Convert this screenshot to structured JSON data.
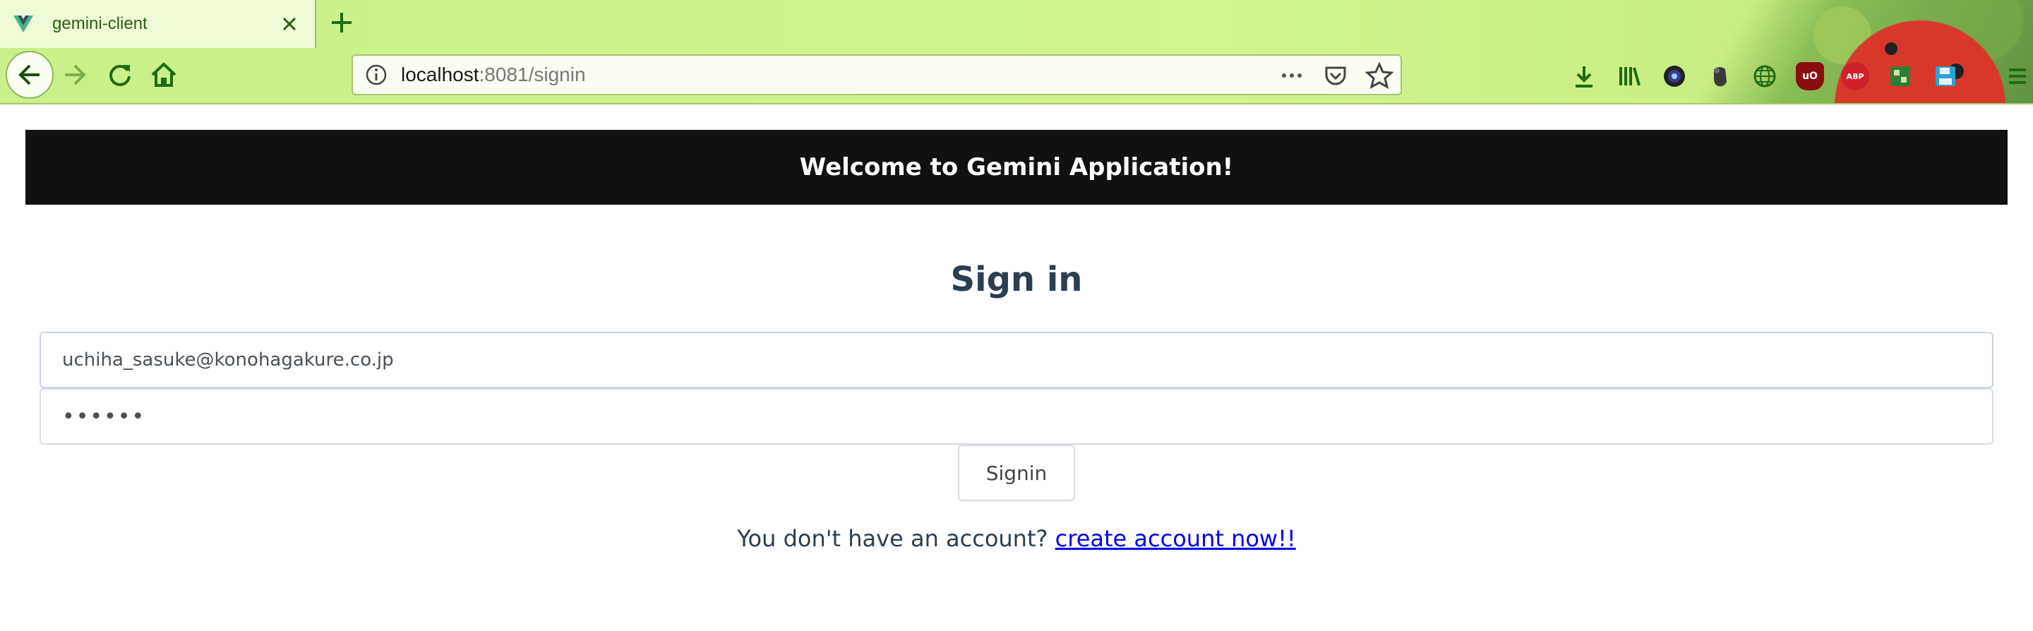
{
  "browser": {
    "tab": {
      "title": "gemini-client",
      "favicon": "vue-logo-icon"
    },
    "url": {
      "host": "localhost",
      "path": ":8081/signin"
    },
    "toolbar_icons": [
      "download-icon",
      "library-icon",
      "camera-extension-icon",
      "evernote-icon",
      "globe-extension-icon",
      "ublock-icon",
      "adblock-icon",
      "extension-icon",
      "save-icon",
      "menu-icon"
    ],
    "extension_labels": {
      "ublock": "uO",
      "adblock": "ABP"
    }
  },
  "page": {
    "banner": "Welcome to Gemini Application!",
    "title": "Sign in",
    "email_value": "uchiha_sasuke@konohagakure.co.jp",
    "password_value": "••••••",
    "signin_button": "Signin",
    "footer_prompt": "You don't have an account?",
    "footer_link": "create account now!!"
  },
  "colors": {
    "chrome_bg": "#c9f08a",
    "banner_bg": "#111111",
    "title_color": "#2c3e50",
    "link_color": "#0000ee"
  }
}
